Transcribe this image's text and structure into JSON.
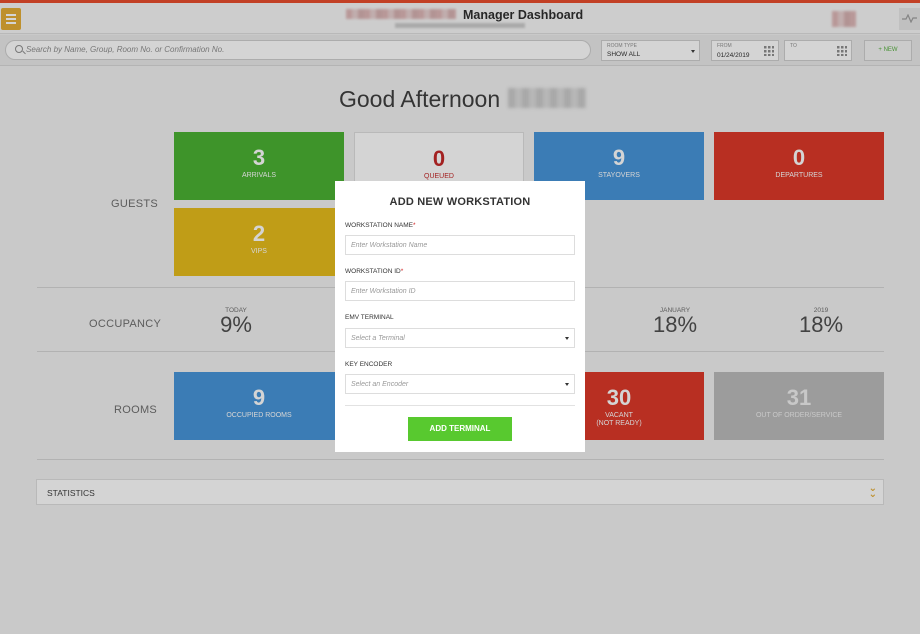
{
  "header": {
    "title": "Manager Dashboard"
  },
  "filters": {
    "search_placeholder": "Search by Name, Group, Room No. or Confirmation No.",
    "room_type_label": "ROOM TYPE",
    "room_type_value": "SHOW ALL",
    "from_label": "FROM",
    "from_value": "01/24/2019",
    "to_label": "TO",
    "to_value": "",
    "new_label": "+ NEW"
  },
  "greeting": "Good Afternoon",
  "sections": {
    "guests": "GUESTS",
    "occupancy": "OCCUPANCY",
    "rooms": "ROOMS"
  },
  "guests": {
    "arrivals": {
      "value": "3",
      "label": "ARRIVALS"
    },
    "queued": {
      "value": "0",
      "label": "QUEUED"
    },
    "stayovers": {
      "value": "9",
      "label": "STAYOVERS"
    },
    "departures": {
      "value": "0",
      "label": "DEPARTURES"
    },
    "vips": {
      "value": "2",
      "label": "VIPS"
    }
  },
  "occupancy": {
    "today": {
      "label": "TODAY",
      "value": "9%"
    },
    "january": {
      "label": "JANUARY",
      "value": "18%"
    },
    "year": {
      "label": "2019",
      "value": "18%"
    }
  },
  "rooms": {
    "occupied": {
      "value": "9",
      "label": "OCCUPIED ROOMS"
    },
    "vacant_not_ready": {
      "value": "30",
      "label1": "VACANT",
      "label2": "(NOT READY)"
    },
    "out_of_order": {
      "value": "31",
      "label": "OUT OF ORDER/SERVICE"
    }
  },
  "statistics": {
    "label": "STATISTICS"
  },
  "modal": {
    "title": "ADD NEW WORKSTATION",
    "workstation_name_label": "WORKSTATION NAME",
    "workstation_name_placeholder": "Enter Workstation Name",
    "workstation_id_label": "WORKSTATION ID",
    "workstation_id_placeholder": "Enter Workstation ID",
    "emv_label": "EMV TERMINAL",
    "emv_placeholder": "Select a Terminal",
    "key_encoder_label": "KEY ENCODER",
    "key_encoder_placeholder": "Select an Encoder",
    "required_mark": "*",
    "submit_label": "ADD TERMINAL"
  },
  "colors": {
    "green": "#3fae26",
    "blue": "#3c8fd8",
    "red": "#dc2c1c",
    "yellow": "#e6b90d",
    "grey": "#b8b8b8",
    "accent": "#e3a82a",
    "button_green": "#58c92f"
  }
}
